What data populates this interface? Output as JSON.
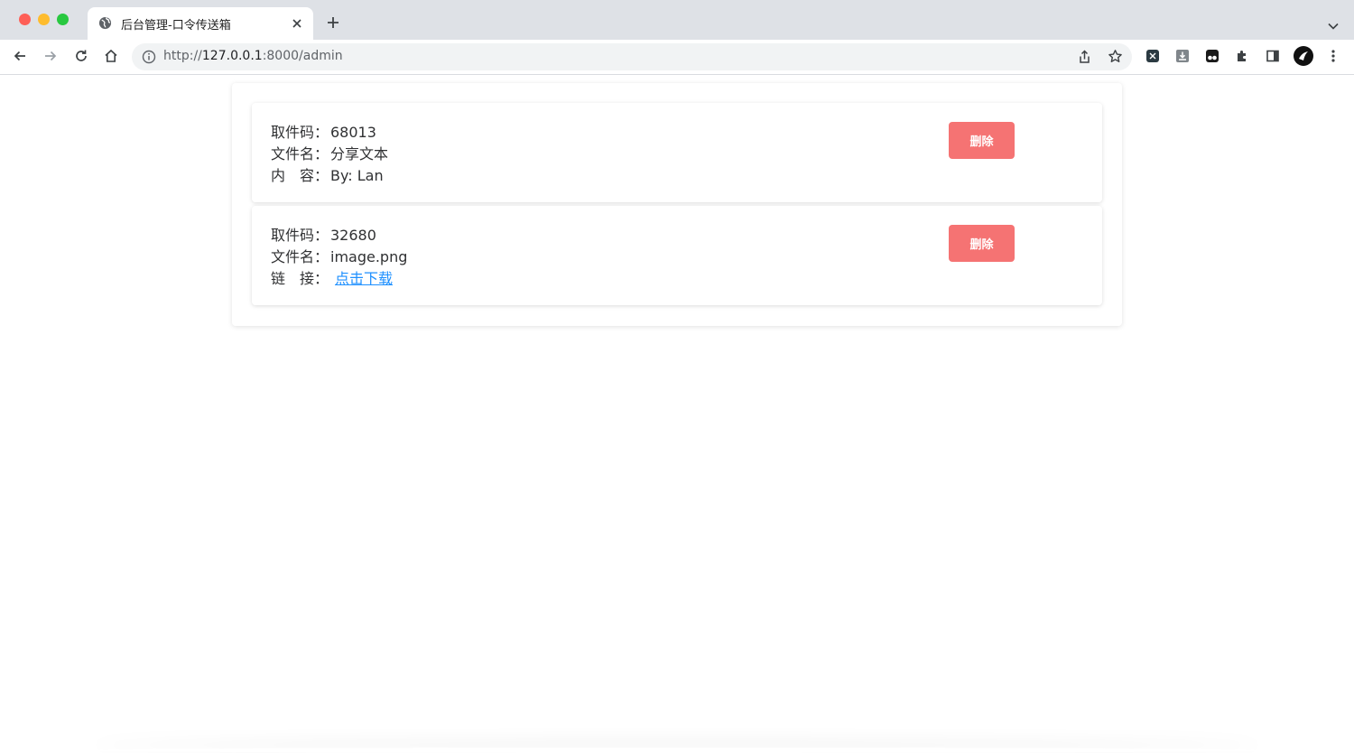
{
  "browser": {
    "tab_title": "后台管理-口令传送箱",
    "url_scheme": "http://",
    "url_host": "127.0.0.1",
    "url_rest": ":8000/admin"
  },
  "records": [
    {
      "code_label": "取件码：",
      "code": "68013",
      "name_label": "文件名：",
      "name": "分享文本",
      "third_label": "内　容：",
      "third_value": "By: Lan",
      "third_is_link": false,
      "delete_label": "删除"
    },
    {
      "code_label": "取件码：",
      "code": "32680",
      "name_label": "文件名：",
      "name": "image.png",
      "third_label": "链　接：",
      "third_value": "点击下载",
      "third_is_link": true,
      "delete_label": "删除"
    }
  ],
  "colors": {
    "danger": "#f56c6c",
    "link": "#1e90ff"
  }
}
